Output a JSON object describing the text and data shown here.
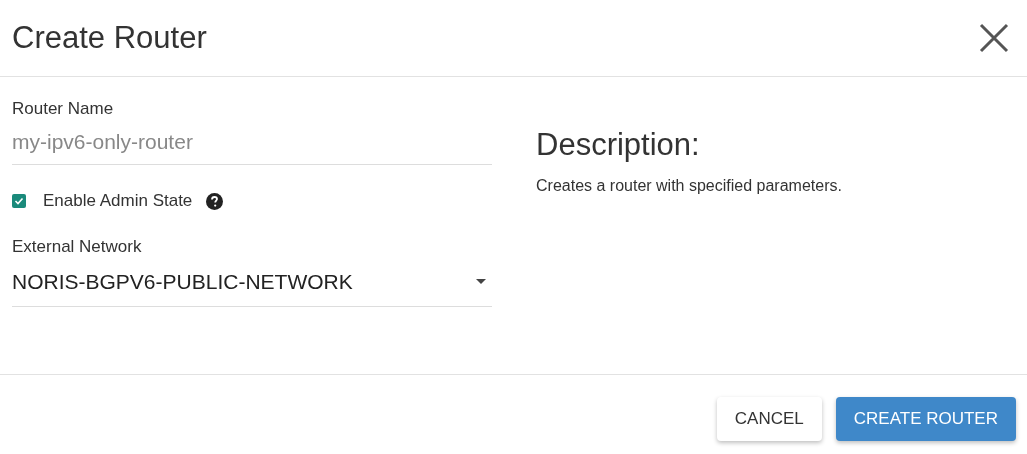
{
  "dialog": {
    "title": "Create Router"
  },
  "form": {
    "router_name": {
      "label": "Router Name",
      "placeholder": "my-ipv6-only-router"
    },
    "admin_state": {
      "label": "Enable Admin State",
      "checked": true
    },
    "external_network": {
      "label": "External Network",
      "value": "NORIS-BGPV6-PUBLIC-NETWORK"
    }
  },
  "description": {
    "heading": "Description:",
    "text": "Creates a router with specified parameters."
  },
  "buttons": [
    {
      "label": "CANCEL",
      "kind": "secondary"
    },
    {
      "label": "CREATE ROUTER",
      "kind": "primary"
    }
  ]
}
